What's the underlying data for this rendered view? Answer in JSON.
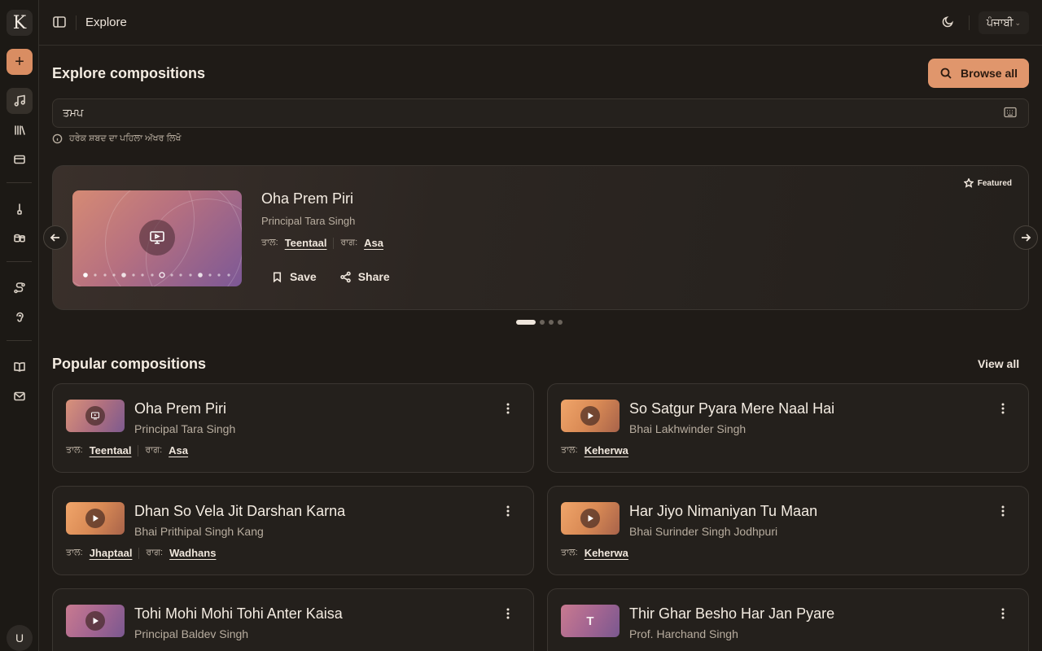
{
  "app": {
    "logo_letter": "K",
    "user_initial": "U"
  },
  "header": {
    "title": "Explore",
    "language": "ਪੰਜਾਬੀ"
  },
  "explore": {
    "heading": "Explore compositions",
    "browse_all": "Browse all",
    "search_value": "ਤਮਪ",
    "hint": "ਹਰੇਕ ਸ਼ਬਦ ਦਾ ਪਹਿਲਾ ਅੱਖਰ ਲਿਖੋ"
  },
  "featured": {
    "badge": "Featured",
    "title": "Oha Prem Piri",
    "artist": "Principal Tara Singh",
    "taal_key": "ਤਾਲ:",
    "taal": "Teentaal",
    "raag_key": "ਰਾਗ:",
    "raag": "Asa",
    "save": "Save",
    "share": "Share",
    "pages": 4,
    "current_page": 1
  },
  "popular": {
    "heading": "Popular compositions",
    "view_all": "View all",
    "items": [
      {
        "title": "Oha Prem Piri",
        "artist": "Principal Tara Singh",
        "taal_key": "ਤਾਲ:",
        "taal": "Teentaal",
        "raag_key": "ਰਾਗ:",
        "raag": "Asa",
        "thumb": "pink",
        "icon": "video-icon"
      },
      {
        "title": "So Satgur Pyara Mere Naal Hai",
        "artist": "Bhai Lakhwinder Singh",
        "taal_key": "ਤਾਲ:",
        "taal": "Keherwa",
        "thumb": "orange",
        "icon": "play-icon"
      },
      {
        "title": "Dhan So Vela Jit Darshan Karna",
        "artist": "Bhai Prithipal Singh Kang",
        "taal_key": "ਤਾਲ:",
        "taal": "Jhaptaal",
        "raag_key": "ਰਾਗ:",
        "raag": "Wadhans",
        "thumb": "orange",
        "icon": "play-icon"
      },
      {
        "title": "Har Jiyo Nimaniyan Tu Maan",
        "artist": "Bhai Surinder Singh Jodhpuri",
        "taal_key": "ਤਾਲ:",
        "taal": "Keherwa",
        "thumb": "orange",
        "icon": "play-icon"
      },
      {
        "title": "Tohi Mohi Mohi Tohi Anter Kaisa",
        "artist": "Principal Baldev Singh",
        "thumb": "mauve",
        "icon": "play-icon"
      },
      {
        "title": "Thir Ghar Besho Har Jan Pyare",
        "artist": "Prof. Harchand Singh",
        "thumb": "mauve",
        "letter": "T"
      }
    ]
  },
  "colors": {
    "accent": "#e0966c",
    "background": "#1f1b17",
    "card": "#24201c"
  }
}
